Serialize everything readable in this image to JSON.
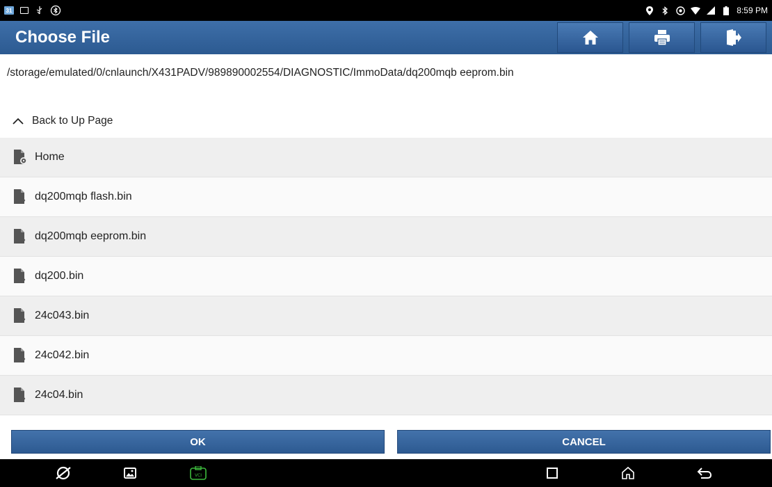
{
  "status_bar": {
    "calendar_badge": "31",
    "time": "8:59 PM",
    "icons_left": [
      "calendar-icon",
      "image-icon",
      "usb-icon",
      "bluetooth-badge-icon"
    ],
    "icons_right": [
      "location-icon",
      "bluetooth-icon",
      "hotspot-icon",
      "wifi-icon",
      "signal-icon",
      "battery-icon"
    ]
  },
  "header": {
    "title": "Choose File",
    "buttons": [
      "home-icon",
      "print-icon",
      "exit-icon"
    ]
  },
  "path": "/storage/emulated/0/cnlaunch/X431PADV/989890002554/DIAGNOSTIC/ImmoData/dq200mqb eeprom.bin",
  "back_label": "Back to Up Page",
  "files": [
    {
      "name": "Home",
      "icon": "folder-settings-icon"
    },
    {
      "name": "dq200mqb flash.bin",
      "icon": "unknown-file-icon"
    },
    {
      "name": "dq200mqb eeprom.bin",
      "icon": "unknown-file-icon"
    },
    {
      "name": "dq200.bin",
      "icon": "unknown-file-icon"
    },
    {
      "name": "24c043.bin",
      "icon": "unknown-file-icon"
    },
    {
      "name": "24c042.bin",
      "icon": "unknown-file-icon"
    },
    {
      "name": "24c04.bin",
      "icon": "unknown-file-icon"
    }
  ],
  "footer": {
    "ok_label": "OK",
    "cancel_label": "CANCEL"
  },
  "nav_bar": {
    "icons": [
      "launcher-icon",
      "gallery-icon",
      "vci-icon",
      "recents-icon",
      "home-nav-icon",
      "back-nav-icon"
    ],
    "vci_label": "VCI"
  },
  "colors": {
    "header_blue": "#2f5d95",
    "vci_green": "#3dbb3d"
  }
}
